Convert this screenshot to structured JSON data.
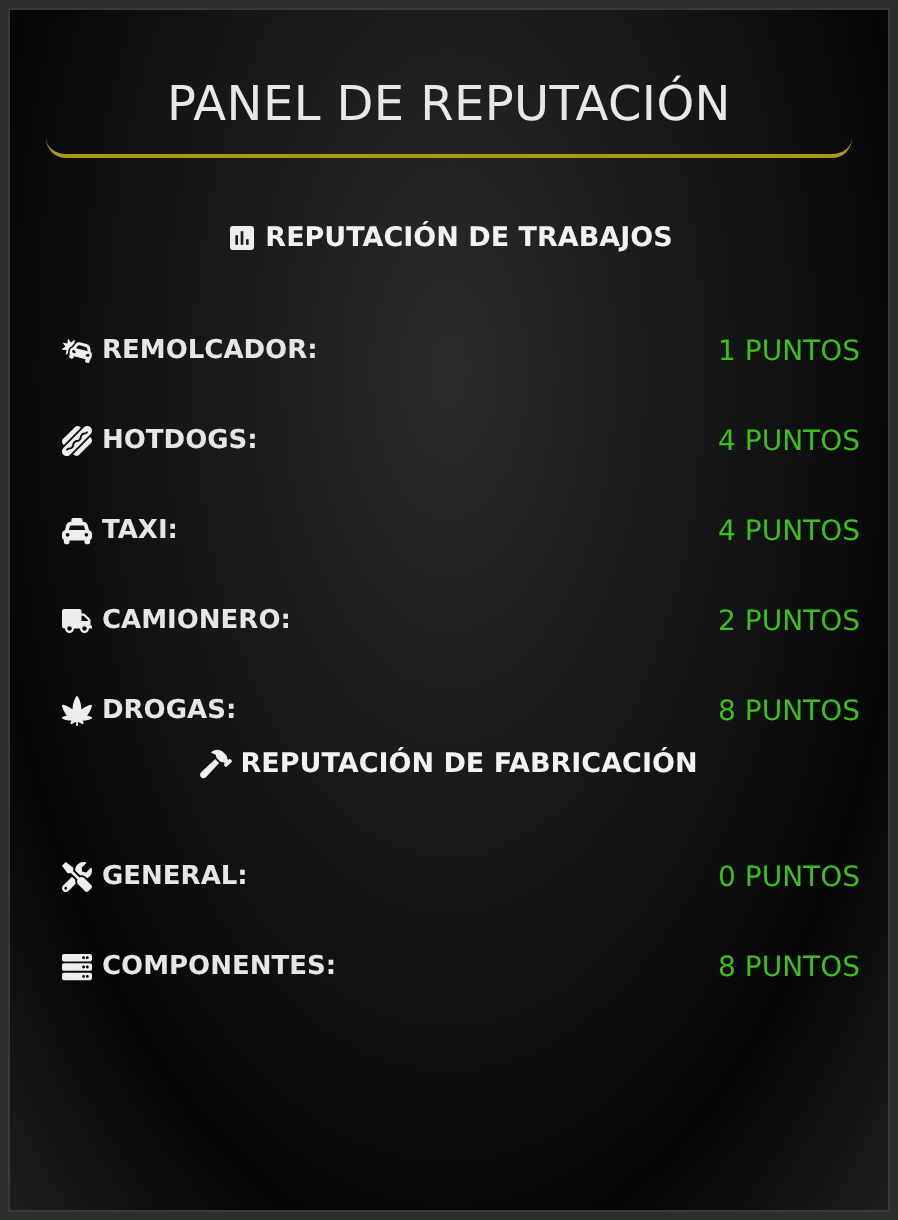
{
  "title": "PANEL DE REPUTACIÓN",
  "sections": [
    {
      "heading": "REPUTACIÓN DE TRABAJOS",
      "rows": [
        {
          "label": "REMOLCADOR:",
          "value": "1 PUNTOS"
        },
        {
          "label": "HOTDOGS:",
          "value": "4 PUNTOS"
        },
        {
          "label": "TAXI:",
          "value": "4 PUNTOS"
        },
        {
          "label": "CAMIONERO:",
          "value": "2 PUNTOS"
        },
        {
          "label": "DROGAS:",
          "value": "8 PUNTOS"
        }
      ]
    },
    {
      "heading": "REPUTACIÓN DE FABRICACIÓN",
      "rows": [
        {
          "label": "GENERAL:",
          "value": "0 PUNTOS"
        },
        {
          "label": "COMPONENTES:",
          "value": "8 PUNTOS"
        }
      ]
    }
  ]
}
